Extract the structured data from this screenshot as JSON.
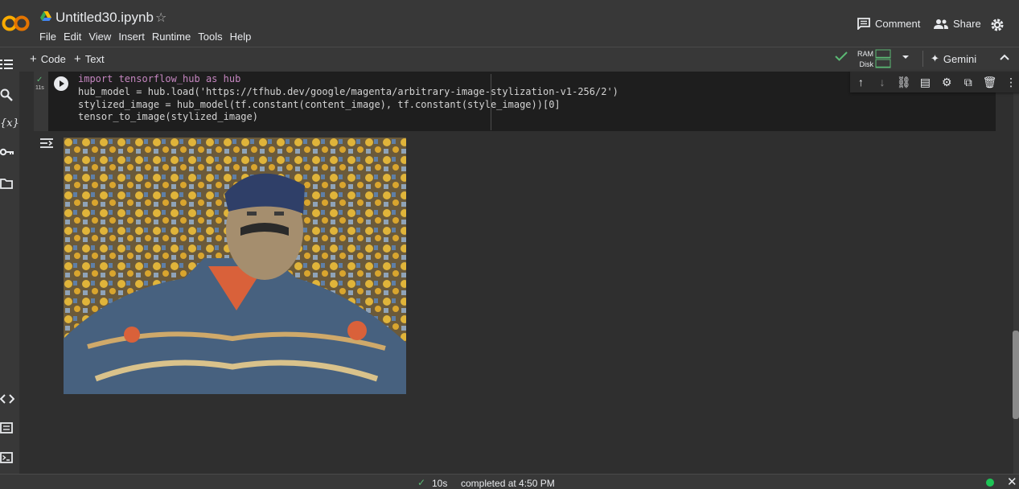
{
  "app": {
    "logo_text": "CO",
    "title": "Untitled30.ipynb"
  },
  "menu": [
    "File",
    "Edit",
    "View",
    "Insert",
    "Runtime",
    "Tools",
    "Help"
  ],
  "header_actions": {
    "comment_label": "Comment",
    "share_label": "Share"
  },
  "toolbar": {
    "add_code_label": "Code",
    "add_text_label": "Text",
    "ram_label": "RAM",
    "disk_label": "Disk",
    "gemini_label": "Gemini"
  },
  "cell": {
    "exec_time": "11s",
    "code_lines": [
      "import tensorflow_hub as hub",
      "hub_model = hub.load('https://tfhub.dev/google/magenta/arbitrary-image-stylization-v1-256/2')",
      "stylized_image = hub_model(tf.constant(content_image), tf.constant(style_image))[0]",
      "tensor_to_image(stylized_image)"
    ]
  },
  "status": {
    "time": "10s",
    "text": "completed at 4:50 PM"
  },
  "colors": {
    "background": "#383838",
    "cell_background": "#1e1e1e",
    "success_green": "#5bb974",
    "status_dot": "#1ec456"
  }
}
